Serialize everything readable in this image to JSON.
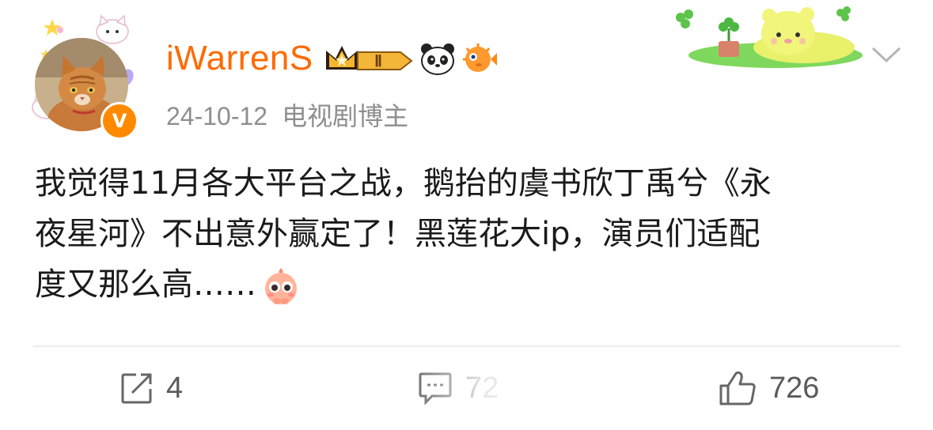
{
  "post": {
    "author": {
      "username": "iWarrenS",
      "level_badge": "Ⅱ",
      "verified": true
    },
    "meta": {
      "date": "24-10-12",
      "source": "电视剧博主"
    },
    "content": {
      "lines": [
        "我觉得11月各大平台之战，鹅抬的虞书欣丁禹兮《永",
        "夜星河》不出意外赢定了！黑莲花大ip，演员们适配",
        "度又那么高……"
      ]
    },
    "actions": {
      "share_count": "4",
      "comment_count": "72",
      "like_count": "726"
    },
    "colors": {
      "username": "#ff6a00",
      "meta": "#8e8e8e",
      "body_text": "#1a1a1a",
      "action_text": "#5a5a5a",
      "verified_badge": "#ff8a00"
    },
    "icons": [
      "share-icon",
      "comment-icon",
      "like-icon",
      "chevron-down-icon",
      "crown-icon",
      "panda-icon",
      "pufferfish-icon"
    ]
  }
}
